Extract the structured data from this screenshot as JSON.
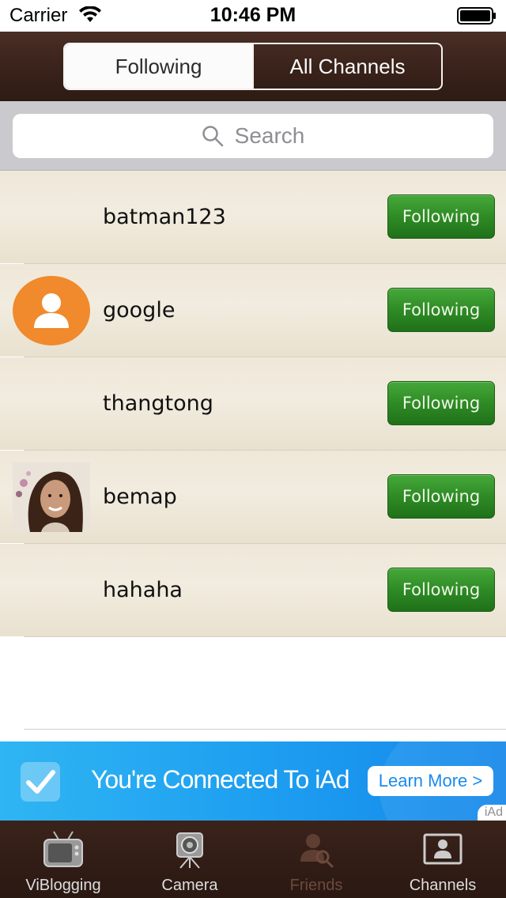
{
  "status_bar": {
    "carrier": "Carrier",
    "time": "10:46 PM"
  },
  "header": {
    "segments": [
      {
        "label": "Following",
        "active": true
      },
      {
        "label": "All Channels",
        "active": false
      }
    ]
  },
  "search": {
    "placeholder": "Search"
  },
  "list": {
    "rows": [
      {
        "name": "batman123",
        "avatar": "none",
        "button": "Following"
      },
      {
        "name": "google",
        "avatar": "default-user-icon",
        "button": "Following"
      },
      {
        "name": "thangtong",
        "avatar": "none",
        "button": "Following"
      },
      {
        "name": "bemap",
        "avatar": "photo",
        "button": "Following"
      },
      {
        "name": "hahaha",
        "avatar": "none",
        "button": "Following"
      }
    ]
  },
  "ad": {
    "text": "You're Connected To iAd",
    "button": "Learn More >",
    "tag": "iAd"
  },
  "tab_bar": {
    "tabs": [
      {
        "label": "ViBlogging",
        "icon": "tv-icon",
        "selected": false
      },
      {
        "label": "Camera",
        "icon": "camera-icon",
        "selected": false
      },
      {
        "label": "Friends",
        "icon": "friends-icon",
        "selected": true
      },
      {
        "label": "Channels",
        "icon": "channels-icon",
        "selected": false
      }
    ]
  },
  "colors": {
    "header_brown": "#3a231b",
    "button_green": "#2f8b25",
    "avatar_orange": "#f08a2c",
    "ad_blue": "#1d9df0"
  }
}
